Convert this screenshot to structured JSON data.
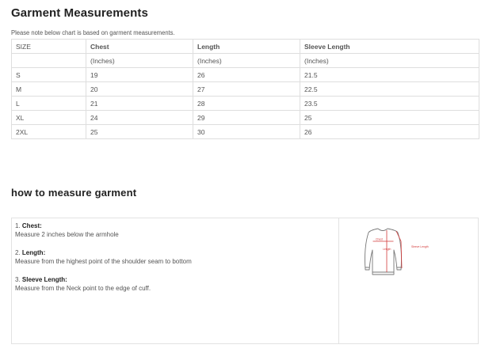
{
  "title": "Garment Measurements",
  "note": "Please note below chart is based on garment measurements.",
  "table": {
    "headers": [
      "SIZE",
      "Chest",
      "Length",
      "Sleeve Length"
    ],
    "units": [
      "",
      "(Inches)",
      "(Inches)",
      "(Inches)"
    ],
    "rows": [
      [
        "S",
        "19",
        "26",
        "21.5"
      ],
      [
        "M",
        "20",
        "27",
        "22.5"
      ],
      [
        "L",
        "21",
        "28",
        "23.5"
      ],
      [
        "XL",
        "24",
        "29",
        "25"
      ],
      [
        "2XL",
        "25",
        "30",
        "26"
      ]
    ]
  },
  "how_title": "how to measure garment",
  "steps": [
    {
      "num": "1.",
      "label": "Chest:",
      "desc": "Measure 2 inches below the armhole"
    },
    {
      "num": "2.",
      "label": "Length:",
      "desc": "Measure from the highest point of the shoulder seam to bottom"
    },
    {
      "num": "3.",
      "label": "Sleeve Length:",
      "desc": "Measure from the Neck point to the edge of cuff."
    }
  ],
  "diagram": {
    "chest_label": "Chest",
    "length_label": "Length",
    "sleeve_label": "Sleeve Length",
    "line_color": "#d33a3a",
    "outline_color": "#777777"
  }
}
